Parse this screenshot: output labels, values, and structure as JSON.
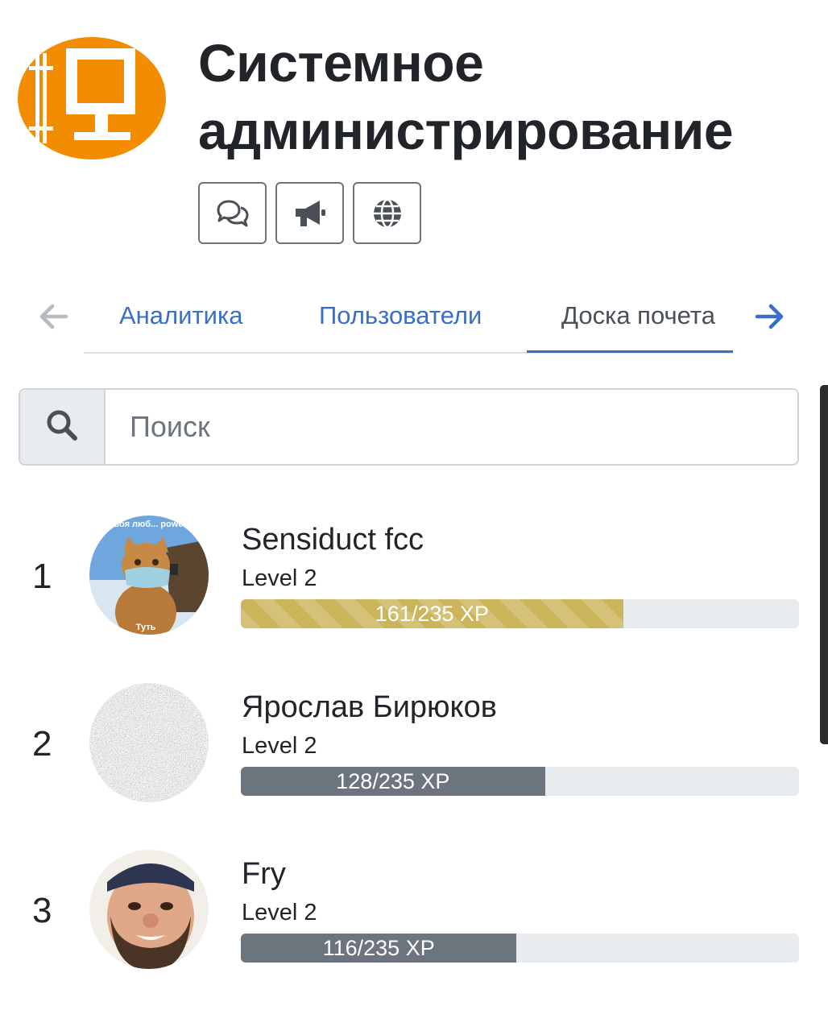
{
  "header": {
    "title": "Системное администрирование",
    "logo_icon": "monitor-icon",
    "logo_color": "#f28c00",
    "buttons": [
      {
        "icon": "chat-icon"
      },
      {
        "icon": "megaphone-icon"
      },
      {
        "icon": "globe-icon"
      }
    ]
  },
  "tabs": {
    "items": [
      {
        "label": "Аналитика",
        "active": false
      },
      {
        "label": "Пользователи",
        "active": false
      },
      {
        "label": "Доска почета",
        "active": true
      }
    ],
    "accent_color": "#3a6fc9"
  },
  "search": {
    "placeholder": "Поиск",
    "value": ""
  },
  "leaderboard": [
    {
      "rank": "1",
      "name": "Sensiduct fcc",
      "level": "Level 2",
      "xp_label": "161/235 XP",
      "xp_fraction": 0.685,
      "bar_style": "gold-striped",
      "avatar": {
        "kind": "photo-cat",
        "top_text": "...где твоя люб... powershell?",
        "bottom_text": "Туть"
      }
    },
    {
      "rank": "2",
      "name": "Ярослав Бирюков",
      "level": "Level 2",
      "xp_label": "128/235 XP",
      "xp_fraction": 0.545,
      "bar_style": "gray",
      "avatar": {
        "kind": "noise"
      }
    },
    {
      "rank": "3",
      "name": "Fry",
      "level": "Level 2",
      "xp_label": "116/235 XP",
      "xp_fraction": 0.494,
      "bar_style": "gray",
      "avatar": {
        "kind": "photo-person"
      }
    }
  ]
}
